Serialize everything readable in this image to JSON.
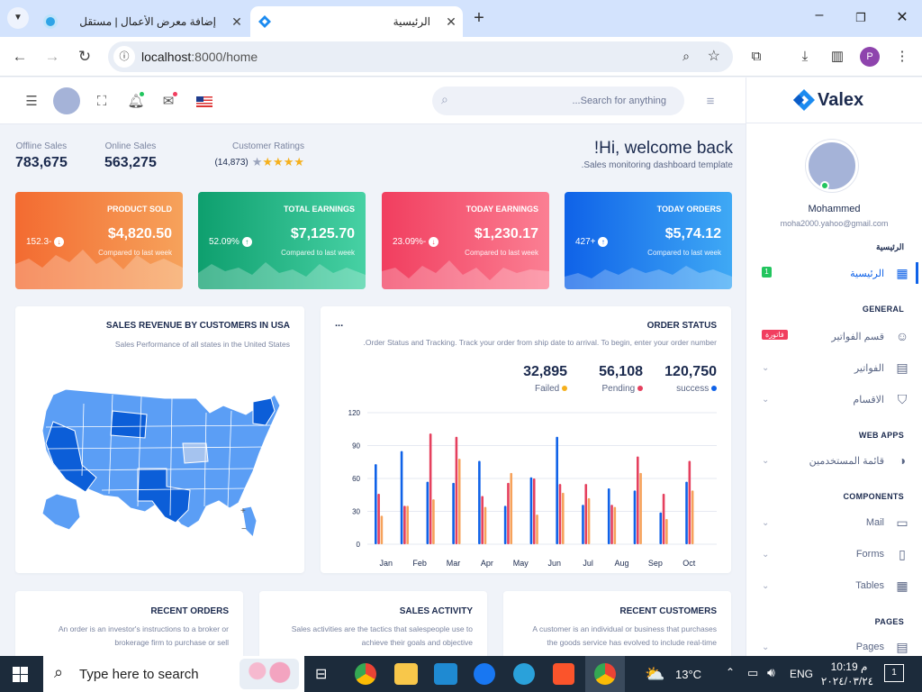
{
  "browser": {
    "tabs": [
      {
        "title": "إضافة معرض الأعمال | مستقل",
        "close": "✕"
      },
      {
        "title": "الرئيسية",
        "close": "✕"
      }
    ],
    "new_tab": "+",
    "url_host": "localhost",
    "url_path": ":8000/home",
    "profile_initial": "P"
  },
  "header": {
    "search_placeholder": "...Search for anything"
  },
  "sidebar": {
    "logo": "Valex",
    "user_name": "Mohammed",
    "user_email": "moha2000.yahoo@gmail.com",
    "sections": [
      {
        "title": "الرئيسية"
      },
      {
        "title": "GENERAL"
      },
      {
        "title": "WEB APPS"
      },
      {
        "title": "COMPONENTS"
      },
      {
        "title": "PAGES"
      }
    ],
    "items": [
      {
        "label": "الرئيسية",
        "badge": "1"
      },
      {
        "label": "قسم الفواتير",
        "badge": "فاتورة"
      },
      {
        "label": "الفواتير"
      },
      {
        "label": "الاقسام"
      },
      {
        "label": "قائمة المستخدمين"
      },
      {
        "label": "Mail"
      },
      {
        "label": "Forms"
      },
      {
        "label": "Tables"
      },
      {
        "label": "Pages"
      }
    ]
  },
  "welcome": {
    "title": "!Hi, welcome back",
    "subtitle": ".Sales monitoring dashboard template"
  },
  "stats": [
    {
      "label": "Offline Sales",
      "value": "783,675"
    },
    {
      "label": "Online Sales",
      "value": "563,275"
    },
    {
      "label": "Customer Ratings",
      "count": "(14,873)",
      "rating": 5
    }
  ],
  "cards": [
    {
      "title": "PRODUCT SOLD",
      "value": "$4,820.50",
      "sub": "Compared to last week",
      "pct": "152.3-",
      "color1": "#f36b31",
      "color2": "#f6a25b"
    },
    {
      "title": "TOTAL EARNINGS",
      "value": "$7,125.70",
      "sub": "Compared to last week",
      "pct": "52.09%",
      "color1": "#0e9f6e",
      "color2": "#47d1a4"
    },
    {
      "title": "TODAY EARNINGS",
      "value": "$1,230.17",
      "sub": "Compared to last week",
      "pct": "23.09%-",
      "color1": "#f13e5f",
      "color2": "#fb7f93"
    },
    {
      "title": "TODAY ORDERS",
      "value": "$5,74.12",
      "sub": "Compared to last week",
      "pct": "427+",
      "color1": "#0f62e8",
      "color2": "#3fa9f5"
    }
  ],
  "usa_panel": {
    "title": "SALES REVENUE BY CUSTOMERS IN USA",
    "subtitle": "Sales Performance of all states in the United States"
  },
  "order_panel": {
    "title": "ORDER STATUS",
    "menu": "...",
    "subtitle": ".Order Status and Tracking. Track your order from ship date to arrival. To begin, enter your order number",
    "summary": [
      {
        "value": "32,895",
        "label": "Failed",
        "color": "#f5b01d"
      },
      {
        "value": "56,108",
        "label": "Pending",
        "color": "#e5405e"
      },
      {
        "value": "120,750",
        "label": "success",
        "color": "#0f62e8"
      }
    ]
  },
  "chart_data": {
    "type": "bar",
    "categories": [
      "Jan",
      "Feb",
      "Mar",
      "Apr",
      "May",
      "Jun",
      "Jul",
      "Aug",
      "Sep",
      "Oct"
    ],
    "ylim": [
      0,
      120
    ],
    "yticks": [
      0,
      30,
      60,
      90,
      120
    ],
    "series": [
      {
        "color": "#0f62e8",
        "values": [
          73,
          85,
          57,
          56,
          76,
          35,
          61,
          98,
          36,
          51,
          49,
          29,
          57
        ]
      },
      {
        "color": "#e5405e",
        "values": [
          46,
          35,
          101,
          98,
          44,
          56,
          60,
          55,
          55,
          36,
          80,
          46,
          76
        ]
      },
      {
        "color": "#f6a25b",
        "values": [
          26,
          35,
          41,
          78,
          34,
          65,
          27,
          47,
          42,
          34,
          65,
          23,
          49
        ]
      }
    ]
  },
  "bottom_panels": [
    {
      "title": "RECENT ORDERS",
      "text1": "An order is an investor's instructions to a broker or",
      "text2": "brokerage firm to purchase or sell"
    },
    {
      "title": "SALES ACTIVITY",
      "text1": "Sales activities are the tactics that salespeople use to",
      "text2": "achieve their goals and objective"
    },
    {
      "title": "RECENT CUSTOMERS",
      "text1": "A customer is an individual or business that purchases",
      "text2": "the goods service has evolved to include real-time"
    }
  ],
  "taskbar": {
    "search_placeholder": "Type here to search",
    "temperature": "13°C",
    "lang": "ENG",
    "time": "10:19 م",
    "date": "٢٠٢٤/٠٣/٢٤",
    "notif": "1"
  }
}
